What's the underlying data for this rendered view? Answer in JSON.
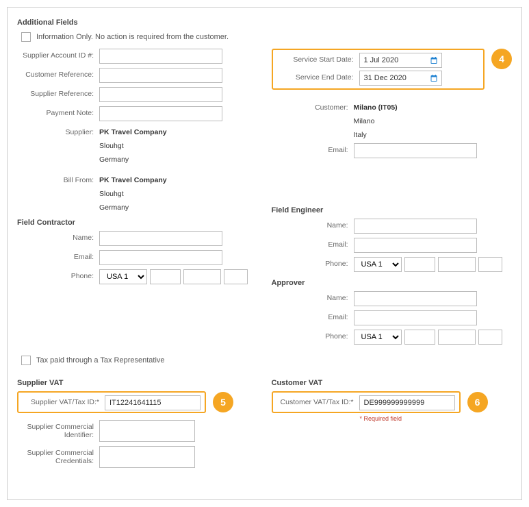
{
  "section_title": "Additional Fields",
  "info_only_label": "Information Only. No action is required from the customer.",
  "labels": {
    "supplier_account_id": "Supplier Account ID #:",
    "customer_reference": "Customer Reference:",
    "supplier_reference": "Supplier Reference:",
    "payment_note": "Payment Note:",
    "supplier": "Supplier:",
    "bill_from": "Bill From:",
    "service_start": "Service Start Date:",
    "service_end": "Service End Date:",
    "customer": "Customer:",
    "email": "Email:",
    "name": "Name:",
    "phone": "Phone:",
    "tax_rep": "Tax paid through a Tax Representative",
    "supplier_vat_section": "Supplier VAT",
    "customer_vat_section": "Customer VAT",
    "supplier_vat_id": "Supplier VAT/Tax ID:*",
    "customer_vat_id": "Customer VAT/Tax ID:*",
    "supplier_comm_id": "Supplier Commercial Identifier:",
    "supplier_comm_cred": "Supplier Commercial Credentials:",
    "field_contractor": "Field Contractor",
    "field_engineer": "Field Engineer",
    "approver": "Approver",
    "required_field": "* Required field"
  },
  "values": {
    "service_start": "1 Jul 2020",
    "service_end": "31 Dec 2020",
    "supplier_vat": "IT12241641115",
    "customer_vat": "DE999999999999"
  },
  "supplier": {
    "name": "PK Travel Company",
    "city": "Slouhgt",
    "country": "Germany"
  },
  "bill_from": {
    "name": "PK Travel Company",
    "city": "Slouhgt",
    "country": "Germany"
  },
  "customer": {
    "name": "Milano (IT05)",
    "city": "Milano",
    "country": "Italy"
  },
  "phone_country": "USA 1",
  "badges": {
    "four": "4",
    "five": "5",
    "six": "6"
  }
}
